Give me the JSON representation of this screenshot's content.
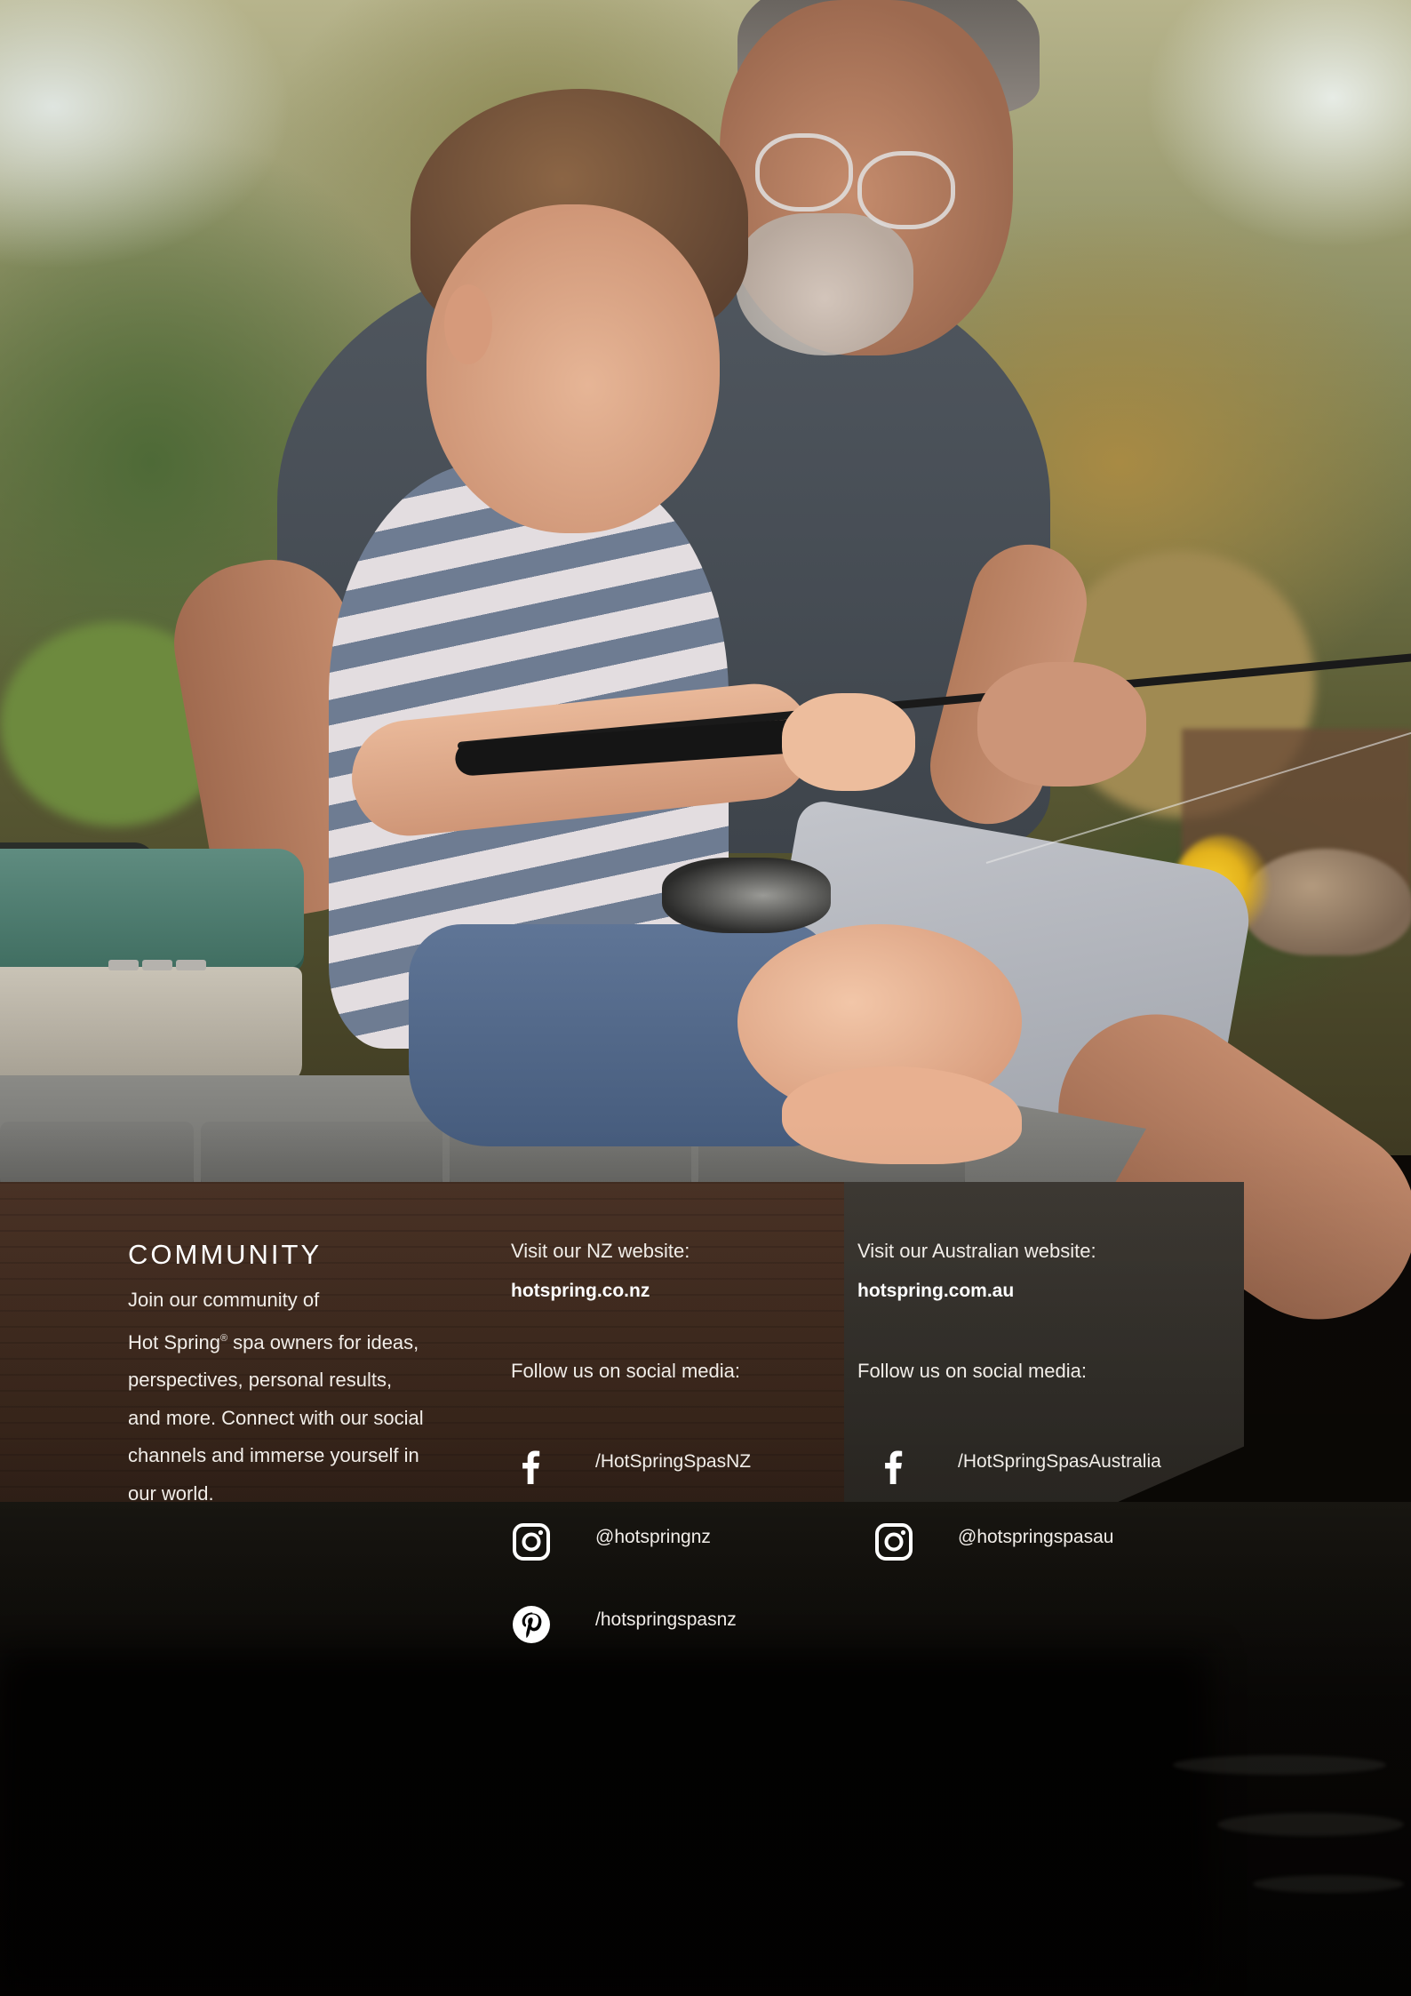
{
  "community": {
    "heading": "COMMUNITY",
    "line1": "Join our community of",
    "line2_brand": "Hot Spring",
    "line2_mark": "®",
    "line2_rest": " spa owners for ideas,",
    "line3": "perspectives, personal results,",
    "line4": "and more. Connect with our social",
    "line5": "channels and immerse yourself in",
    "line6": "our world."
  },
  "nz": {
    "visit_label": "Visit our NZ website:",
    "site": "hotspring.co.nz",
    "follow_label": "Follow us on social media:",
    "facebook": "/HotSpringSpasNZ",
    "instagram": "@hotspringnz",
    "pinterest": "/hotspringspasnz"
  },
  "au": {
    "visit_label": "Visit our Australian website:",
    "site": "hotspring.com.au",
    "follow_label": "Follow us on social media:",
    "facebook": "/HotSpringSpasAustralia",
    "instagram": "@hotspringspasau"
  },
  "icons": {
    "facebook": "facebook-icon",
    "instagram": "instagram-icon",
    "pinterest": "pinterest-icon"
  },
  "colors": {
    "text": "#ffffff",
    "body_text": "#f1ede8"
  }
}
